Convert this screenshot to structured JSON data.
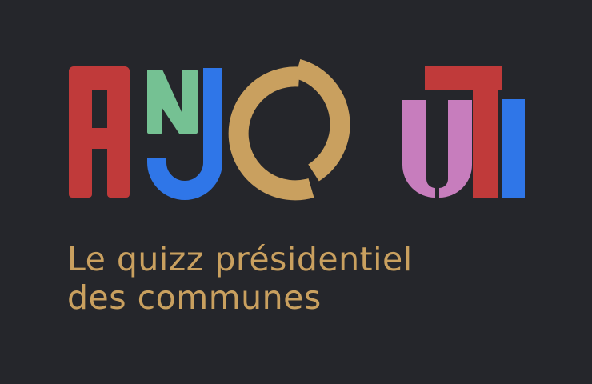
{
  "logo": {
    "word": "ANJOUTE",
    "letters": [
      {
        "char": "A",
        "color": "#c03a3a"
      },
      {
        "char": "N",
        "color": "#75c193"
      },
      {
        "char": "J",
        "color": "#2f76e8"
      },
      {
        "char": "O",
        "color": "#c9a05f"
      },
      {
        "char": "U",
        "color": "#c77dbd"
      },
      {
        "char": "T",
        "color": "#c03a3a"
      },
      {
        "char": "E",
        "color": "#2f76e8"
      }
    ]
  },
  "tagline": {
    "line1": "Le quizz présidentiel",
    "line2": "des communes"
  },
  "colors": {
    "background": "#25262b",
    "tagline": "#c9a05f"
  }
}
